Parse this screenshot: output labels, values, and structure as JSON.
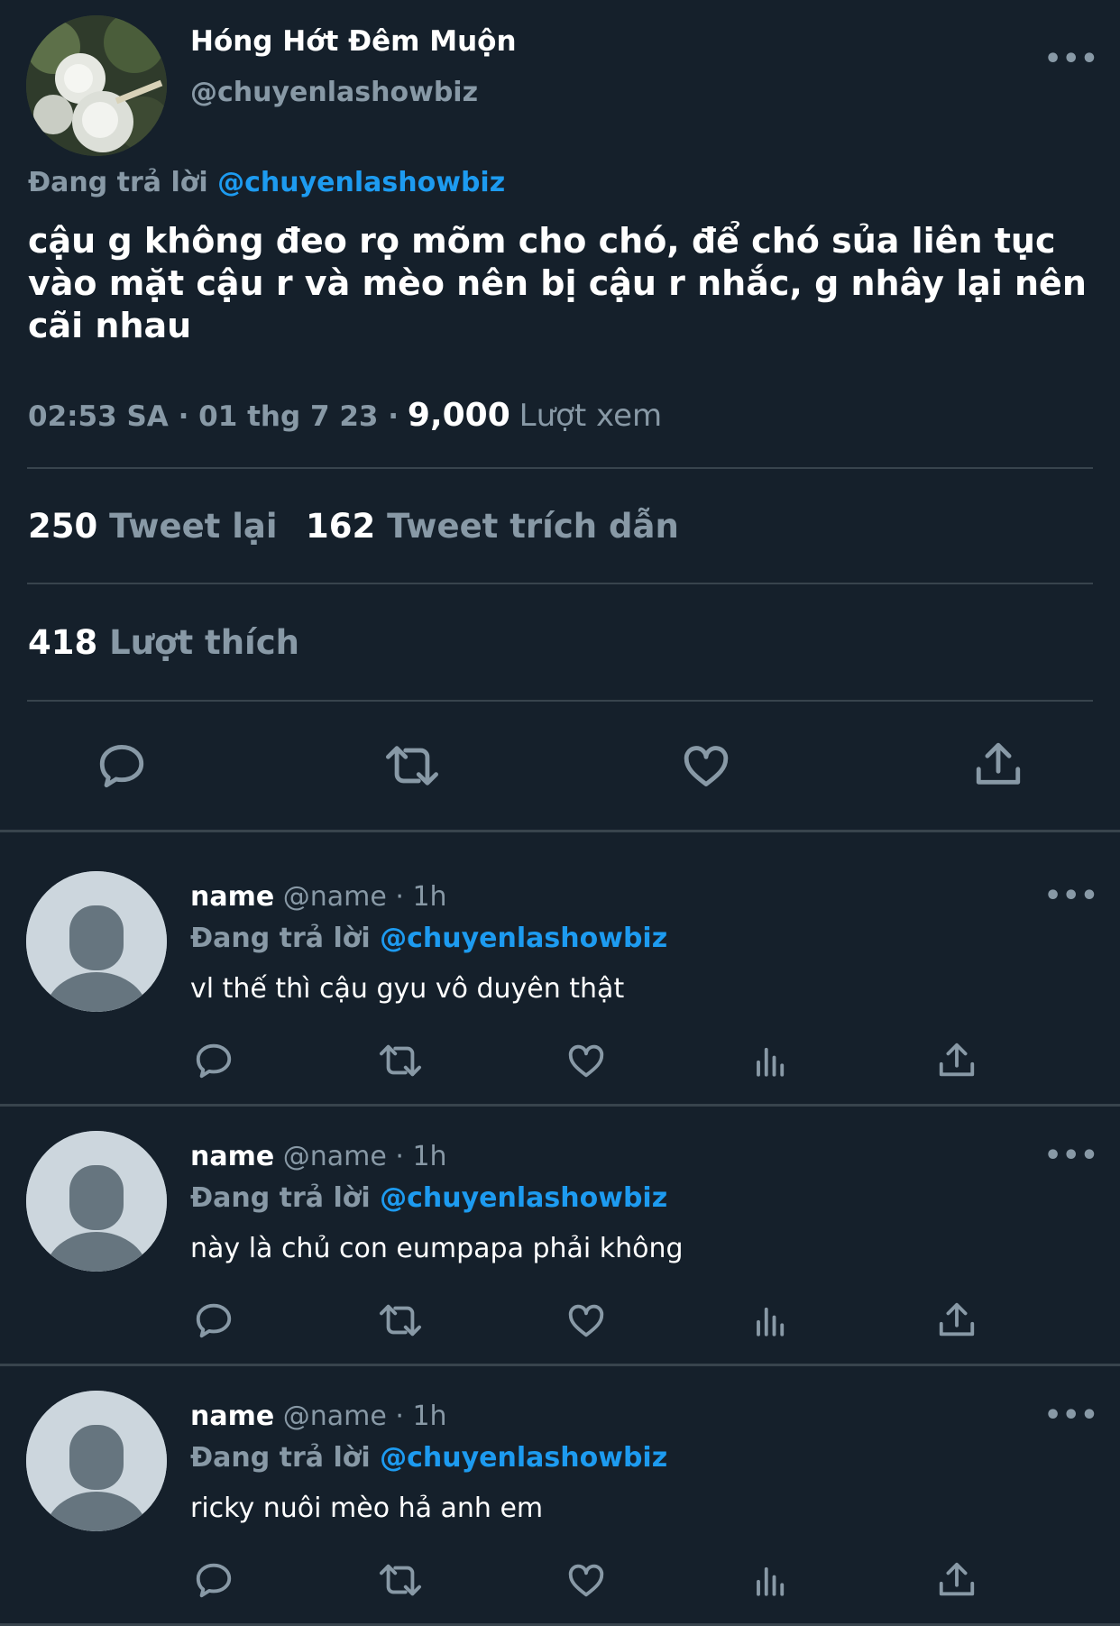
{
  "main_tweet": {
    "author_name": "Hóng Hớt Đêm Muộn",
    "author_handle": "@chuyenlashowbiz",
    "more_label": "•••",
    "replying_prefix": "Đang trả lời",
    "replying_handle": "@chuyenlashowbiz",
    "text": "cậu g không đeo rọ mõm cho chó, để  chó sủa liên tục vào mặt cậu r và mèo nên bị cậu r nhắc, g nhây lại nên cãi nhau",
    "time": "02:53 SA · 01 thg 7 23 ·",
    "views_count": "9,000",
    "views_label": "Lượt xem",
    "retweets_count": "250",
    "retweets_label": "Tweet lại",
    "quotes_count": "162",
    "quotes_label": "Tweet trích dẫn",
    "likes_count": "418",
    "likes_label": "Lượt thích"
  },
  "replies": [
    {
      "name": "name",
      "meta": "@name · 1h",
      "replying_prefix": "Đang trả lời",
      "replying_handle": "@chuyenlashowbiz",
      "text": "vl thế thì cậu gyu vô duyên thật",
      "more_label": "•••"
    },
    {
      "name": "name",
      "meta": "@name · 1h",
      "replying_prefix": "Đang trả lời",
      "replying_handle": "@chuyenlashowbiz",
      "text": "này là chủ con eumpapa phải không",
      "more_label": "•••"
    },
    {
      "name": "name",
      "meta": "@name · 1h",
      "replying_prefix": "Đang trả lời",
      "replying_handle": "@chuyenlashowbiz",
      "text": "ricky nuôi mèo hả anh em",
      "more_label": "•••"
    }
  ],
  "icons": {
    "reply": "comment-bubble-icon",
    "retweet": "retweet-icon",
    "like": "heart-icon",
    "views": "analytics-icon",
    "share": "share-icon"
  },
  "colors": {
    "background": "#15202b",
    "accent": "#1d9bf0",
    "secondary_text": "#8899a6",
    "divider": "#38444d"
  }
}
